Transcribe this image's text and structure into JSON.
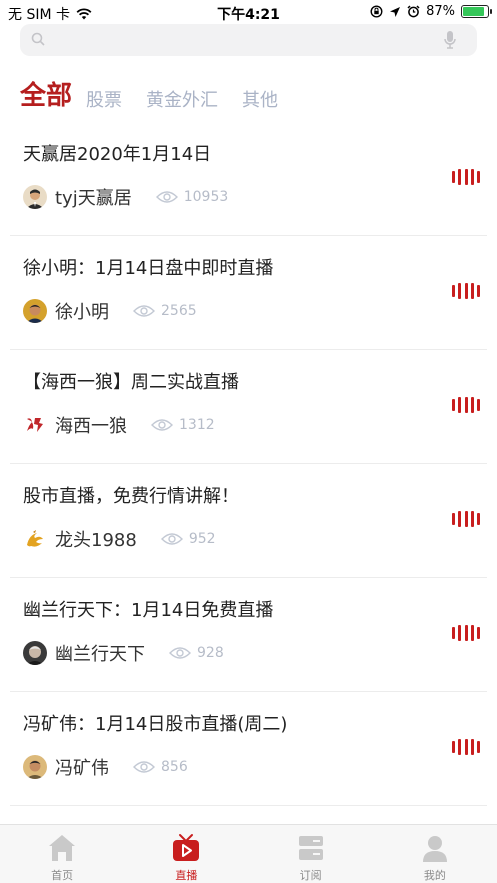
{
  "status_bar": {
    "carrier": "无 SIM 卡",
    "time": "下午4:21",
    "battery_percent": "87%",
    "battery_level": 0.87,
    "icons": [
      "wifi-icon",
      "rotation-lock-icon",
      "location-icon",
      "alarm-icon",
      "battery-icon"
    ]
  },
  "search": {
    "placeholder": ""
  },
  "tabs": [
    {
      "label": "全部",
      "active": true
    },
    {
      "label": "股票",
      "active": false
    },
    {
      "label": "黄金外汇",
      "active": false
    },
    {
      "label": "其他",
      "active": false
    }
  ],
  "broadcasts": [
    {
      "title": "天赢居2020年1月14日",
      "author": "tyj天赢居",
      "views": "10953",
      "avatar": "avatar-tyj"
    },
    {
      "title": "徐小明：1月14日盘中即时直播",
      "author": "徐小明",
      "views": "2565",
      "avatar": "avatar-xu"
    },
    {
      "title": "【海西一狼】周二实战直播",
      "author": "海西一狼",
      "views": "1312",
      "avatar": "avatar-haixi"
    },
    {
      "title": "股市直播，免费行情讲解！",
      "author": "龙头1988",
      "views": "952",
      "avatar": "avatar-longtou"
    },
    {
      "title": "幽兰行天下：1月14日免费直播",
      "author": "幽兰行天下",
      "views": "928",
      "avatar": "avatar-youlan"
    },
    {
      "title": "冯矿伟：1月14日股市直播(周二)",
      "author": "冯矿伟",
      "views": "856",
      "avatar": "avatar-feng"
    }
  ],
  "tabbar": [
    {
      "label": "首页",
      "icon": "home-icon",
      "active": false
    },
    {
      "label": "直播",
      "icon": "tv-play-icon",
      "active": true
    },
    {
      "label": "订阅",
      "icon": "subscribe-icon",
      "active": false
    },
    {
      "label": "我的",
      "icon": "user-icon",
      "active": false
    }
  ],
  "colors": {
    "accent": "#c81e1e",
    "tab_active": "#b51e1e",
    "tab_inactive": "#aab3c6",
    "muted_text": "#b6bcc8"
  }
}
